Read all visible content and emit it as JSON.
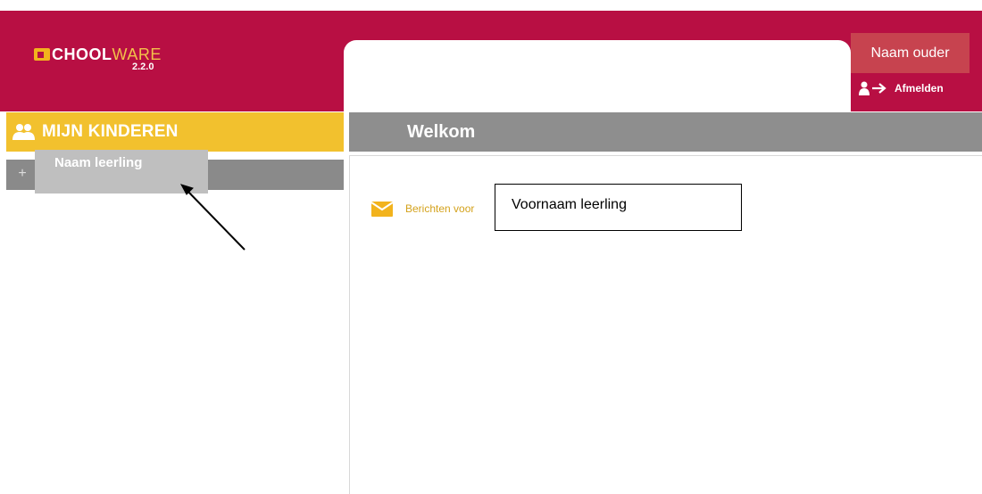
{
  "header": {
    "logo": {
      "brand_main": "CHOOL",
      "brand_accent": "WARE",
      "version": "2.2.0"
    },
    "user_name": "Naam ouder",
    "logout_label": "Afmelden"
  },
  "sidebar": {
    "title": "MIJN KINDEREN",
    "expand_symbol": "+",
    "student_name": "Naam leerling"
  },
  "main": {
    "title": "Welkom",
    "messages_label": "Berichten voor"
  },
  "annotation": {
    "callout_text": "Voornaam leerling"
  },
  "colors": {
    "brand": "#b80f43",
    "accent_yellow": "#f2c12e",
    "user_box": "#c7434f",
    "header_grey": "#8e8e8e",
    "message_text": "#d4a21c"
  },
  "icons": {
    "logo_icon": "schoolware-logo-icon",
    "user_logout_icon": "user-logout-icon",
    "children_icon": "group-users-icon",
    "messages_icon": "envelope-icon"
  }
}
